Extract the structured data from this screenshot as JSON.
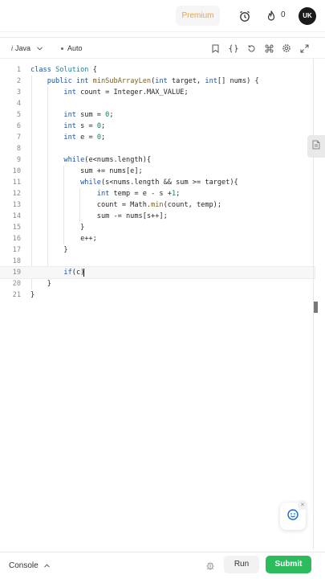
{
  "header": {
    "premium_label": "Premium",
    "streak_count": "0",
    "avatar_initials": "UK",
    "premium_color": "#f0a23b"
  },
  "toolbar": {
    "language": "Java",
    "mode": "Auto"
  },
  "code": {
    "lines": [
      {
        "n": "1",
        "text": "class Solution {"
      },
      {
        "n": "2",
        "text": "    public int minSubArrayLen(int target, int[] nums) {"
      },
      {
        "n": "3",
        "text": "        int count = Integer.MAX_VALUE;"
      },
      {
        "n": "4",
        "text": ""
      },
      {
        "n": "5",
        "text": "        int sum = 0;"
      },
      {
        "n": "6",
        "text": "        int s = 0;"
      },
      {
        "n": "7",
        "text": "        int e = 0;"
      },
      {
        "n": "8",
        "text": ""
      },
      {
        "n": "9",
        "text": "        while(e<nums.length){"
      },
      {
        "n": "10",
        "text": "            sum += nums[e];"
      },
      {
        "n": "11",
        "text": "            while(s<nums.length && sum >= target){"
      },
      {
        "n": "12",
        "text": "                int temp = e - s +1;"
      },
      {
        "n": "13",
        "text": "                count = Math.min(count, temp);"
      },
      {
        "n": "14",
        "text": "                sum -= nums[s++];"
      },
      {
        "n": "15",
        "text": "            }"
      },
      {
        "n": "16",
        "text": "            e++;"
      },
      {
        "n": "17",
        "text": "        }"
      },
      {
        "n": "18",
        "text": ""
      },
      {
        "n": "19",
        "text": "        if(c)"
      },
      {
        "n": "20",
        "text": "    }"
      },
      {
        "n": "21",
        "text": "}"
      }
    ],
    "active_line": 19
  },
  "footer": {
    "console_label": "Console",
    "run_label": "Run",
    "submit_label": "Submit",
    "submit_color": "#2cbb5d"
  },
  "icons": {
    "header": [
      "alarm-clock-icon",
      "flame-icon"
    ],
    "toolbar": [
      "bookmark-icon",
      "braces-icon",
      "reset-icon",
      "command-icon",
      "settings-icon",
      "expand-icon"
    ],
    "side": "document-icon",
    "assistant": "chat-assistant-icon",
    "footer": "bug-icon"
  }
}
